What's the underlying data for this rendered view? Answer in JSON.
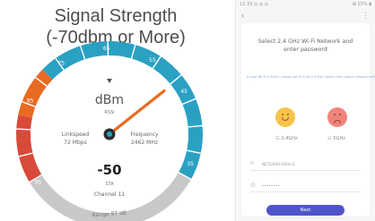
{
  "infographic": {
    "title_line1": "Signal Strength",
    "title_line2": "(-70dbm or More)",
    "gauge": {
      "scale_labels": [
        "95",
        "85",
        "75",
        "65",
        "55",
        "45",
        "35"
      ],
      "unit": "dBm",
      "sub_unit": "RSSI",
      "reading": "-50",
      "reading_label": "STA",
      "needle_value": -50,
      "left_info_label": "Linkspeed",
      "left_info_value": "72 Mbps",
      "right_info_label": "Frequency",
      "right_info_value": "2462 MHz",
      "channel": "Channel 11",
      "range": "Range 97 dB",
      "colors": {
        "blue": "#2aa1c3",
        "orange": "#e86a22",
        "red": "#d84a3a",
        "grey": "#c8c8c8"
      }
    }
  },
  "phone": {
    "status_left": "12:33 ◎ ◎ ◎",
    "status_right": "⊠ 55% ▮",
    "back_icon": "chevron-left-icon",
    "heading": "Select 2.4 GHz Wi-Fi Network and enter password",
    "link_text": "If your Wi-Fi is 5GHz, please set it to be 2.4GHz. Learn more about network settings",
    "band_24": "2.4GHz",
    "band_5": "5GHz",
    "ssid_value": "NETGEAR-5GHz-S",
    "password_value": "••••••••",
    "next_label": "Next",
    "colors": {
      "button": "#4f55c8",
      "good_face": "#f7c34a",
      "bad_face": "#f0857c"
    }
  }
}
